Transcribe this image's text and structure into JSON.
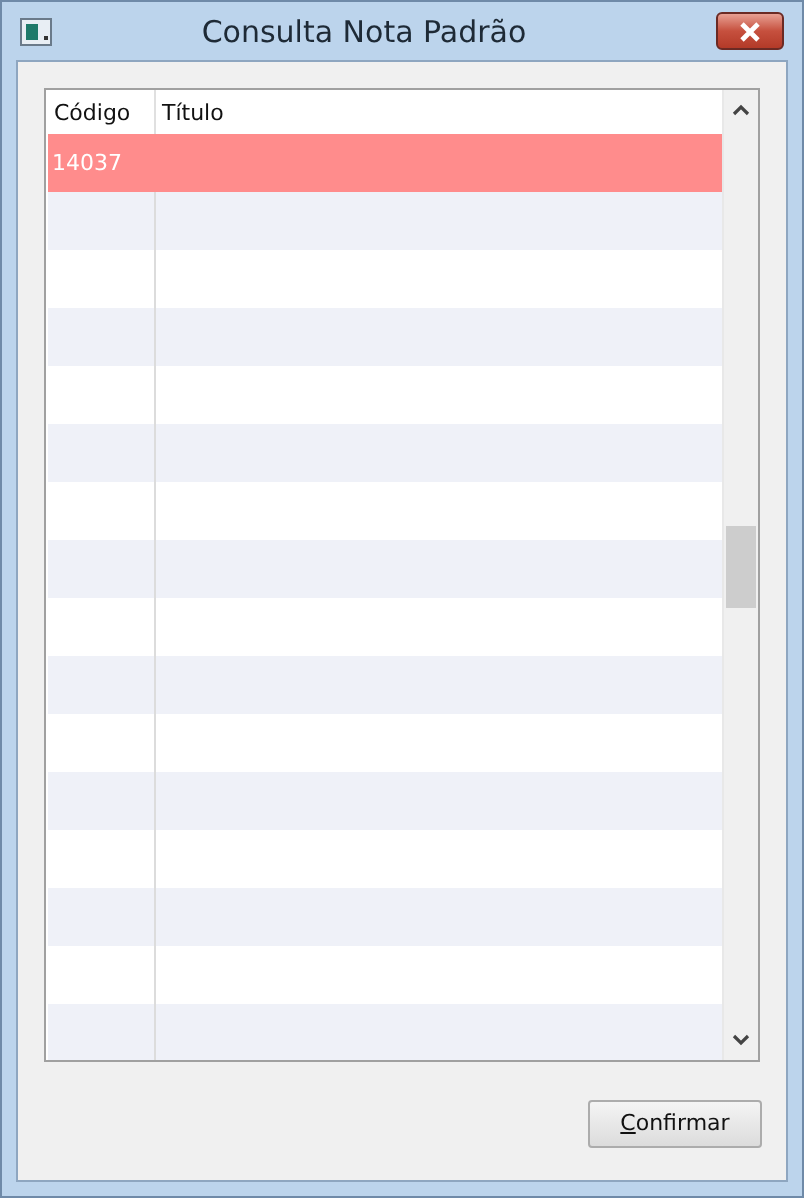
{
  "window": {
    "title": "Consulta Nota Padrão"
  },
  "table": {
    "columns": [
      "Código",
      "Título"
    ],
    "rows": [
      {
        "codigo": "14037",
        "selected": true
      }
    ]
  },
  "buttons": [
    {
      "label": "Confirmar"
    }
  ]
}
